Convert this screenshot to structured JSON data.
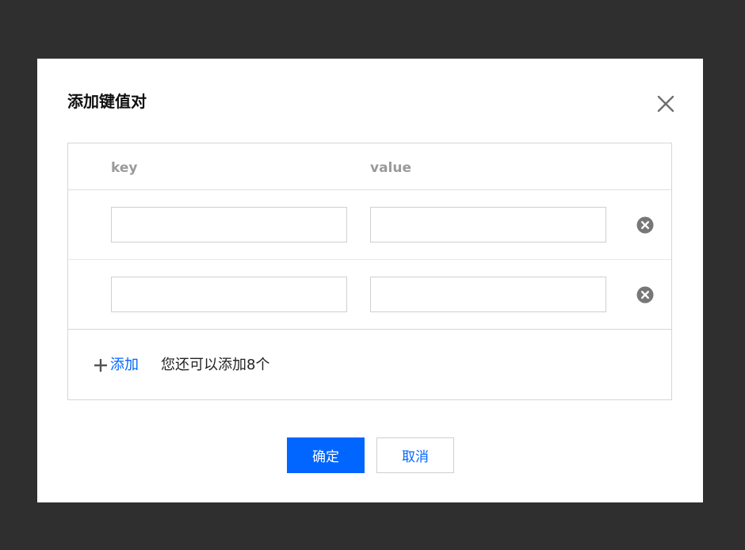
{
  "dialog": {
    "title": "添加键值对",
    "close_icon": "close-icon"
  },
  "table": {
    "columns": {
      "key": "key",
      "value": "value"
    },
    "rows": [
      {
        "key": "",
        "value": "",
        "delete_icon": "remove-circle-icon"
      },
      {
        "key": "",
        "value": "",
        "delete_icon": "remove-circle-icon"
      }
    ]
  },
  "add": {
    "icon": "plus-icon",
    "label": "添加",
    "remaining_text": "您还可以添加8个"
  },
  "footer": {
    "confirm_label": "确定",
    "cancel_label": "取消"
  },
  "colors": {
    "accent": "#0066ff",
    "overlay": "#2f2f2f",
    "delete_icon": "#777777"
  }
}
